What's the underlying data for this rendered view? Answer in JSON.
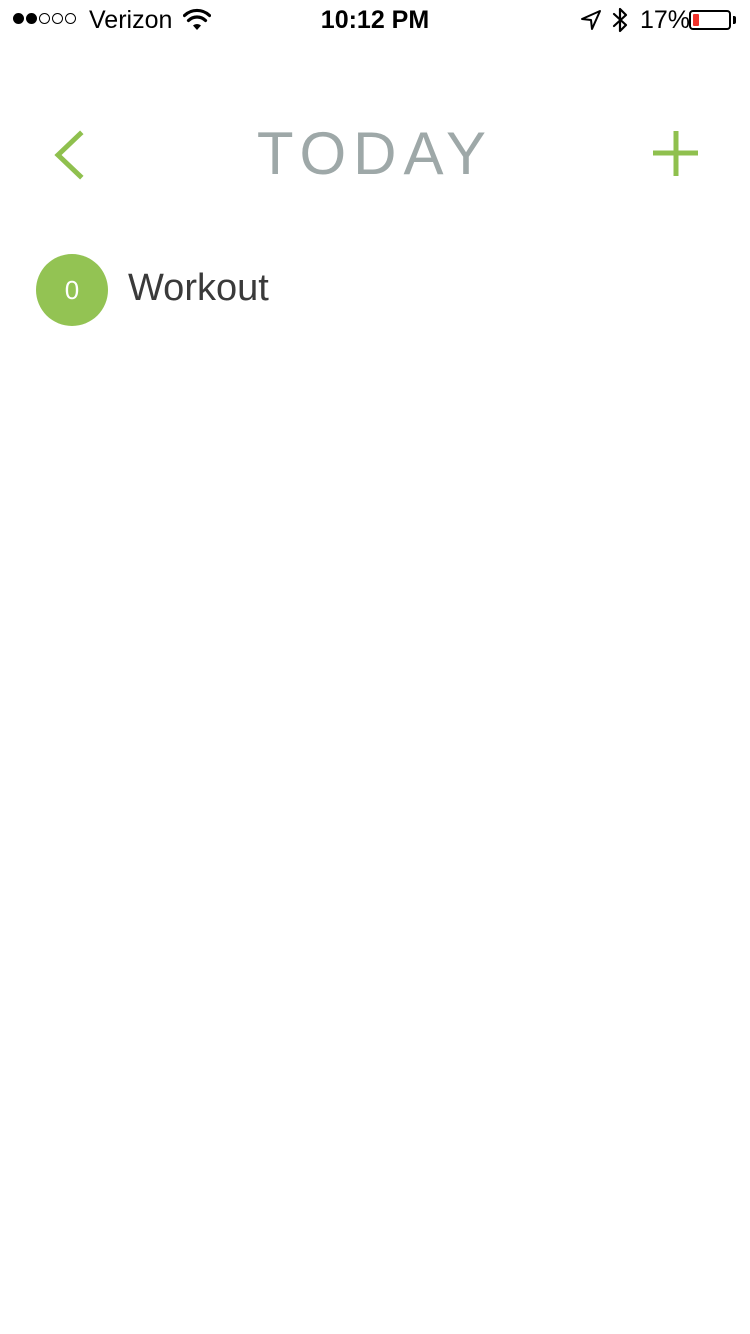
{
  "status_bar": {
    "signal_bars_filled": 2,
    "signal_bars_total": 5,
    "carrier": "Verizon",
    "time": "10:12 PM",
    "battery_percent": "17%",
    "battery_level": 0.17,
    "battery_color": "#f0312a",
    "icons": [
      "wifi-icon",
      "location-arrow-icon",
      "bluetooth-icon",
      "battery-icon"
    ]
  },
  "header": {
    "title": "TODAY",
    "title_color": "#9ea8a8",
    "back_icon": "chevron-left-icon",
    "add_icon": "plus-icon",
    "accent_color": "#8fc04e"
  },
  "items": [
    {
      "count": "0",
      "label": "Workout",
      "badge_color": "#93c353"
    }
  ]
}
